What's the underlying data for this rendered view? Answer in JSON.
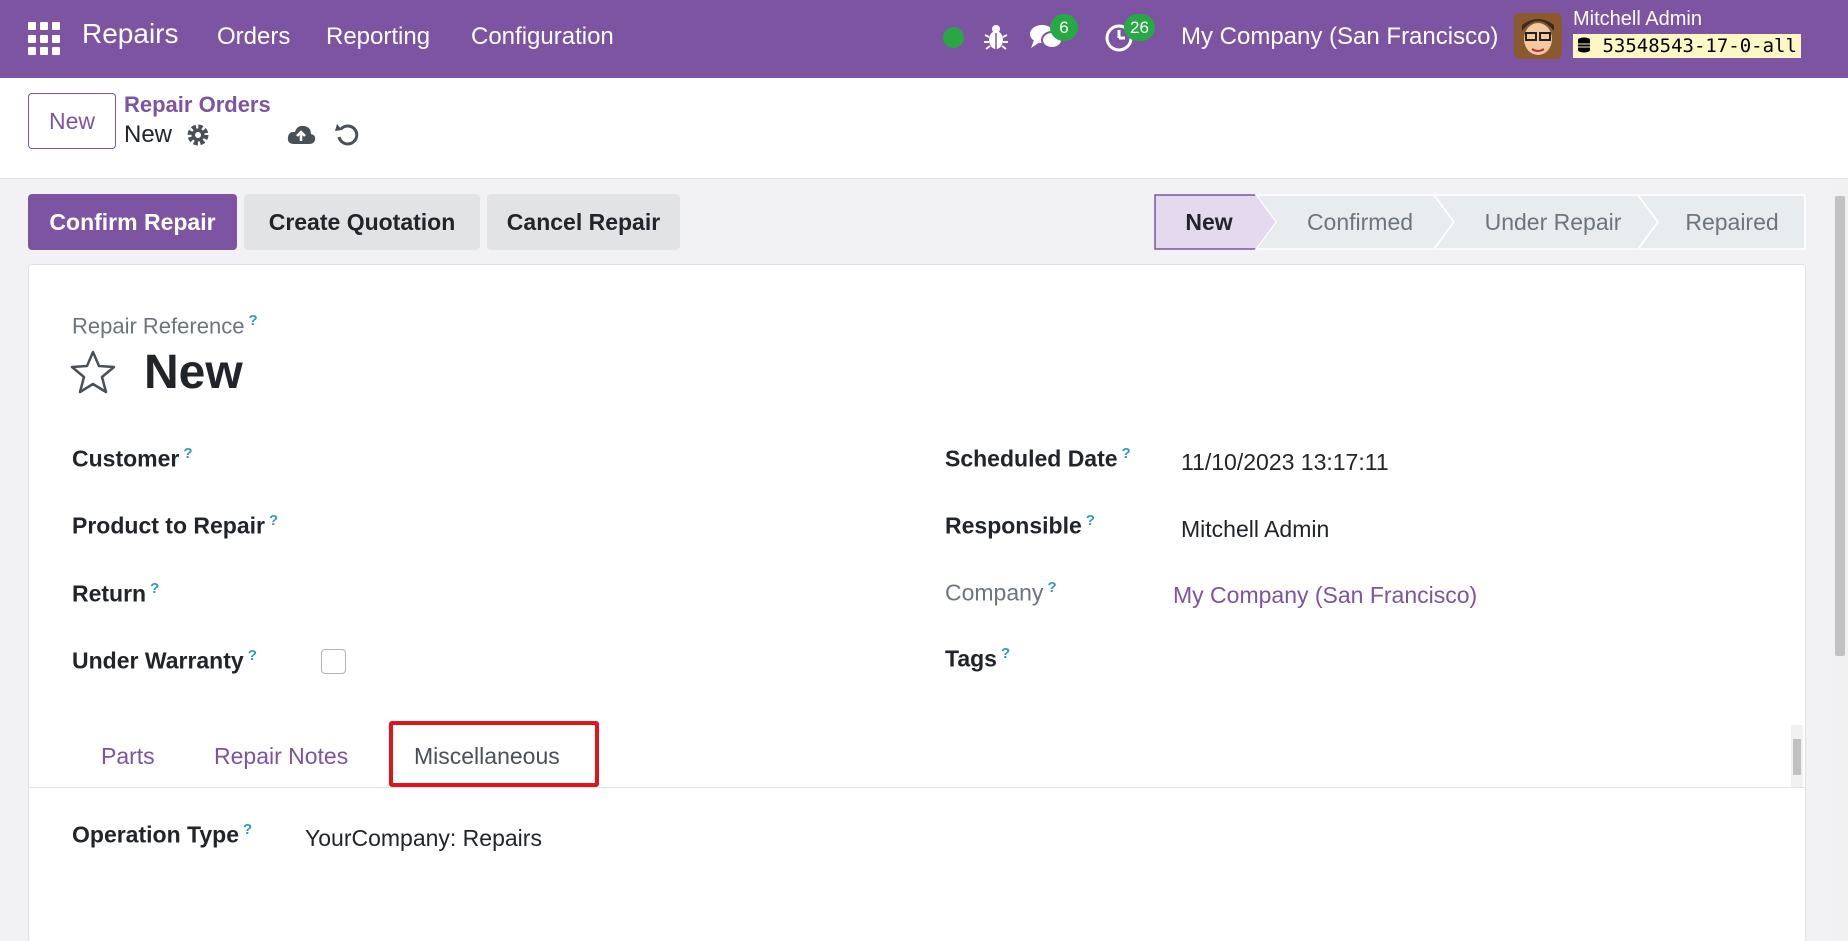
{
  "navbar": {
    "app_name": "Repairs",
    "menu": [
      "Orders",
      "Reporting",
      "Configuration"
    ],
    "messages_count": "6",
    "activities_count": "26",
    "company": "My Company (San Francisco)",
    "user_name": "Mitchell Admin",
    "database": "53548543-17-0-all"
  },
  "control_panel": {
    "new_button": "New",
    "breadcrumb_parent": "Repair Orders",
    "breadcrumb_current": "New"
  },
  "actions": {
    "confirm": "Confirm Repair",
    "quotation": "Create Quotation",
    "cancel": "Cancel Repair"
  },
  "status": {
    "steps": [
      "New",
      "Confirmed",
      "Under Repair",
      "Repaired"
    ],
    "active": "New"
  },
  "form": {
    "reference_label": "Repair Reference",
    "title": "New",
    "fields": {
      "customer": "Customer",
      "product": "Product to Repair",
      "return": "Return",
      "warranty": "Under Warranty",
      "scheduled_date_label": "Scheduled Date",
      "scheduled_date": "11/10/2023 13:17:11",
      "responsible_label": "Responsible",
      "responsible": "Mitchell Admin",
      "company_label": "Company",
      "company": "My Company (San Francisco)",
      "tags": "Tags"
    },
    "help_mark": "?",
    "tabs": [
      "Parts",
      "Repair Notes",
      "Miscellaneous"
    ],
    "active_tab": "Miscellaneous",
    "operation_type_label": "Operation Type",
    "operation_type": "YourCompany: Repairs"
  },
  "colors": {
    "brand": "#7c54a2",
    "success": "#28a745",
    "highlight": "#e0141b"
  }
}
